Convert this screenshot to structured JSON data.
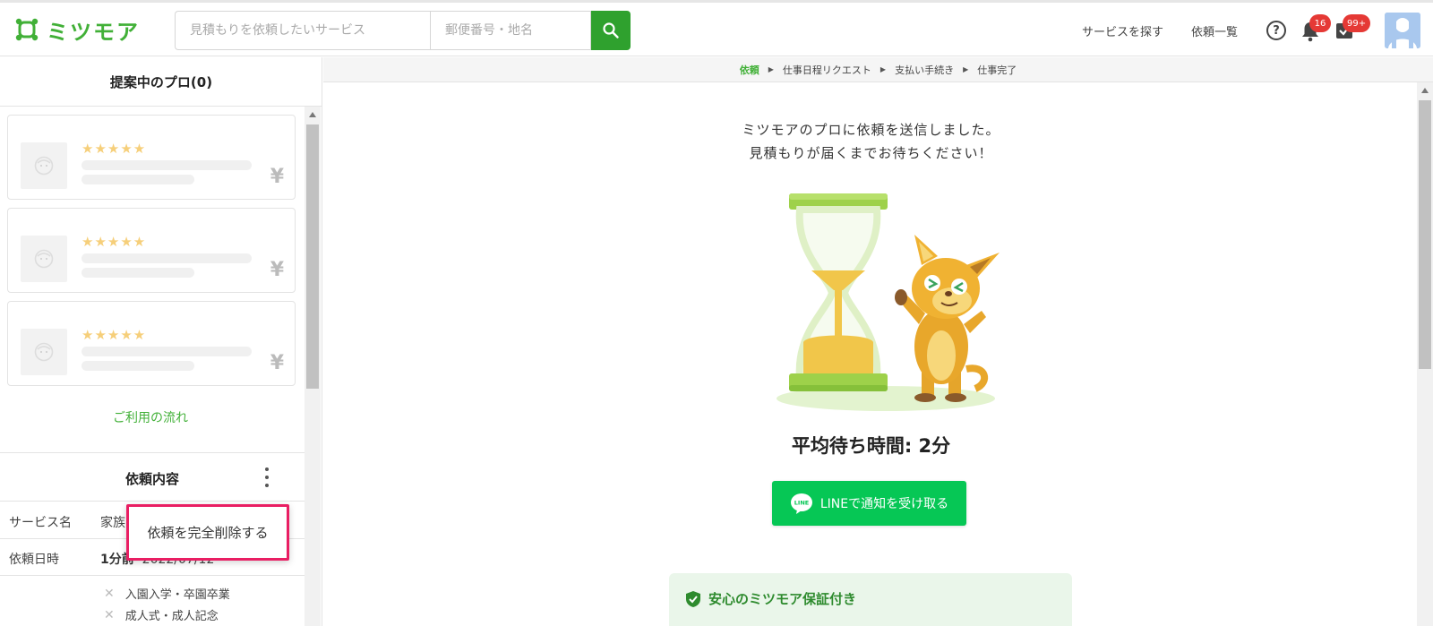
{
  "header": {
    "logo_text": "ミツモア",
    "search_service_placeholder": "見積もりを依頼したいサービス",
    "search_zip_placeholder": "郵便番号・地名",
    "nav_find_services": "サービスを探す",
    "nav_requests": "依頼一覧",
    "help_glyph": "?",
    "notification_count": "16",
    "task_count": "99+"
  },
  "sidebar": {
    "title": "提案中のプロ(0)",
    "pro_cards": [
      {
        "stars": "★★★★★",
        "yen": "¥"
      },
      {
        "stars": "★★★★★",
        "yen": "¥"
      },
      {
        "stars": "★★★★★",
        "yen": "¥"
      }
    ],
    "flow_link": "ご利用の流れ",
    "request_section": {
      "title": "依頼内容",
      "rows": [
        {
          "label": "サービス名",
          "value": "家族"
        },
        {
          "label": "依頼日時",
          "relative": "1分前",
          "date": "2022/07/12"
        }
      ],
      "tags": [
        "入園入学・卒園卒業",
        "成人式・成人記念"
      ]
    },
    "dropdown_item": "依頼を完全削除する"
  },
  "breadcrumb": {
    "steps": [
      "依頼",
      "仕事日程リクエスト",
      "支払い手続き",
      "仕事完了"
    ]
  },
  "main": {
    "message_line1": "ミツモアのプロに依頼を送信しました。",
    "message_line2": "見積もりが届くまでお待ちください！",
    "wait_time": "平均待ち時間: 2分",
    "line_button": "LINEで通知を受け取る",
    "line_icon_text": "LINE",
    "guarantee_title": "安心のミツモア保証付き"
  },
  "colors": {
    "brand_green": "#41b037",
    "search_button": "#2fa12e",
    "line_green": "#06c755",
    "badge_red": "#e53935",
    "highlight_pink": "#e91e63"
  },
  "icons": {
    "search": "search-icon",
    "help": "help-icon",
    "bell": "bell-icon",
    "task": "task-check-icon",
    "avatar": "avatar-icon",
    "kebab": "more-vertical-icon",
    "line": "line-chat-icon",
    "shield": "shield-check-icon"
  }
}
